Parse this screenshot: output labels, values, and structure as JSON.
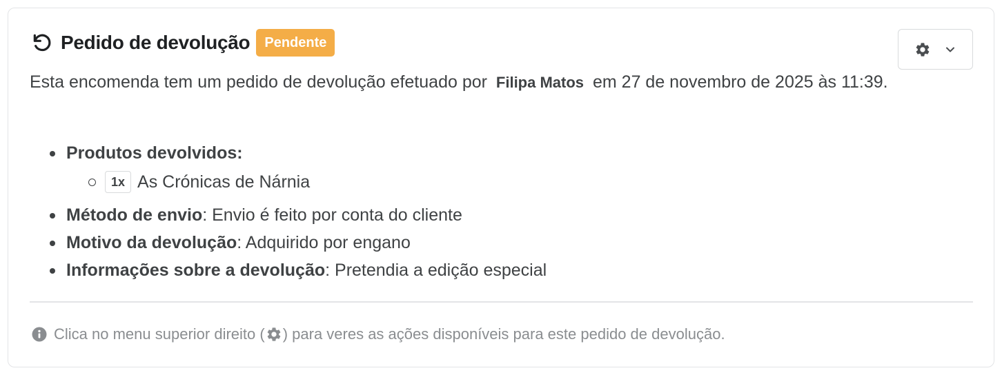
{
  "header": {
    "title": "Pedido de devolução",
    "status_badge": "Pendente",
    "icon": "undo-icon"
  },
  "menu": {
    "icons": [
      "gear-icon",
      "chevron-down-icon"
    ]
  },
  "intro": {
    "text_before": "Esta encomenda tem um pedido de devolução efetuado por",
    "customer_name": "Filipa Matos",
    "text_after": "em 27 de novembro de 2025 às 11:39."
  },
  "details": {
    "products_label": "Produtos devolvidos:",
    "products": [
      {
        "quantity": "1x",
        "name": "As Crónicas de Nárnia"
      }
    ],
    "shipping_label": "Método de envio",
    "shipping_value": ": Envio é feito por conta do cliente",
    "reason_label": "Motivo da devolução",
    "reason_value": ": Adquirido por engano",
    "info_label": "Informações sobre a devolução",
    "info_value": ": Pretendia a edição especial"
  },
  "footer": {
    "note_before": "Clica no menu superior direito (",
    "note_after": ") para veres as ações disponíveis para este pedido de devolução."
  },
  "colors": {
    "badge": "#f4ad47",
    "text": "#3f4244",
    "muted": "#8a8d90",
    "border": "#e3e4e6"
  }
}
